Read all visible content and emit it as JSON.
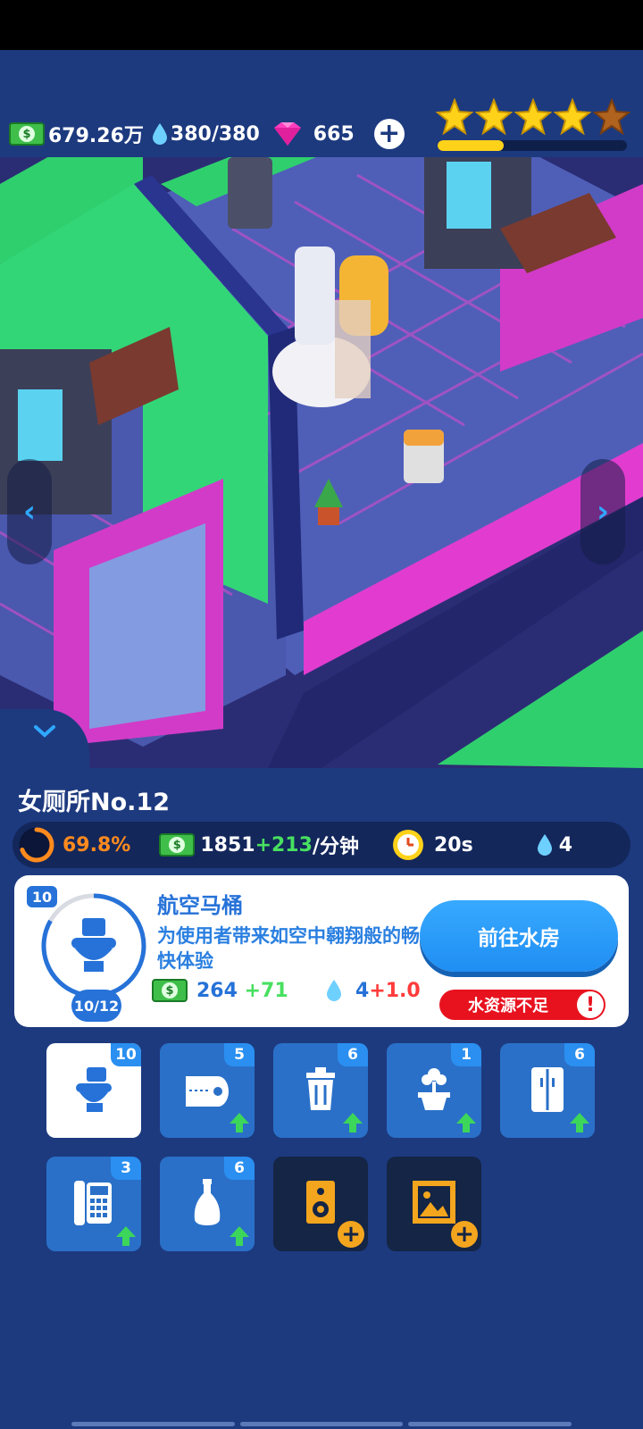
{
  "hud": {
    "cash": "679.26万",
    "water": "380/380",
    "gems": "665",
    "stars_filled": 4,
    "stars_total": 5,
    "level_progress_percent": 35
  },
  "room": {
    "title": "女厕所No.12",
    "progress": "69.8%",
    "income_base": "1851",
    "income_bonus": "+213",
    "income_unit": "/分钟",
    "time": "20s",
    "water_use": "4"
  },
  "item": {
    "level": "10",
    "name": "航空马桶",
    "description": "为使用者带来如空中翱翔般的畅快体验",
    "count": "10/12",
    "income": "264",
    "income_bonus": "+71",
    "water": "4",
    "water_bonus": "+1.0",
    "goto_button": "前往水房",
    "warning": "水资源不足"
  },
  "slots": [
    {
      "icon": "toilet-icon",
      "count": "10",
      "selected": true
    },
    {
      "icon": "toilet-paper-icon",
      "count": "5",
      "upgrade": true
    },
    {
      "icon": "trash-can-icon",
      "count": "6",
      "upgrade": true
    },
    {
      "icon": "plant-icon",
      "count": "1",
      "upgrade": true
    },
    {
      "icon": "fridge-icon",
      "count": "6",
      "upgrade": true
    },
    {
      "icon": "telephone-icon",
      "count": "3",
      "upgrade": true
    },
    {
      "icon": "bottle-icon",
      "count": "6",
      "upgrade": true
    },
    {
      "icon": "speaker-icon",
      "locked": true
    },
    {
      "icon": "picture-frame-icon",
      "locked": true
    }
  ],
  "colors": {
    "panel_bg": "#1d3a7f",
    "accent_blue": "#2672d8",
    "warning_red": "#e8121f",
    "bonus_green": "#48e060",
    "progress_orange": "#ff8a1e"
  }
}
